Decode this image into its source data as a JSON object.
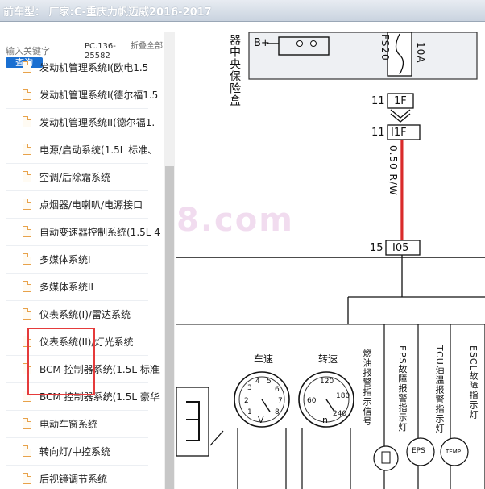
{
  "window": {
    "title": "前车型： 厂家:C-重庆力帆迈威2016-2017"
  },
  "search": {
    "placeholder": "输入关键字",
    "button": "查询",
    "code": "PC.136-25582",
    "fold": "折叠全部"
  },
  "tree": {
    "partial_item": "发动机管理系统I(欧电1.5",
    "items": [
      "发动机管理系统I(德尔福1.5",
      "发动机管理系统II(德尔福1.",
      "电源/启动系统(1.5L 标准、",
      "空调/后除霜系统",
      "点烟器/电喇叭/电源接口",
      "自动变速器控制系统(1.5L 4",
      "多媒体系统I",
      "多媒体系统II",
      "仪表系统(I)/雷达系统",
      "仪表系统(II)/灯光系统",
      "BCM 控制器系统(1.5L 标准",
      "BCM 控制器系统(1.5L 豪华",
      "电动车窗系统",
      "转向灯/中控系统",
      "后视镜调节系统"
    ]
  },
  "diagram": {
    "fuse_box_label": "器中央保险盒",
    "b_plus": "B+",
    "fuse_name": "FS20",
    "fuse_rating": "10A",
    "conn1_pin": "11",
    "conn1_name": "1F",
    "conn2_pin": "11",
    "conn2_name": "I1F",
    "wire_label": "0.50 R/W",
    "conn3_pin": "15",
    "conn3_name": "I05",
    "gauges": {
      "tach_label": "车速",
      "speed_label": "转速",
      "tach_ticks": [
        "1",
        "2",
        "3",
        "4",
        "5",
        "6",
        "7",
        "8"
      ],
      "speed_ticks": [
        "60",
        "120",
        "180",
        "240"
      ],
      "v_label": "V",
      "n_label": "n"
    },
    "indicators": [
      "燃油报警指示信号",
      "EPS故障报警指示灯",
      "TCU油温报警指示灯",
      "ESCL故障指示灯"
    ],
    "badges": [
      "EPS",
      "TEMP"
    ],
    "watermark": "8.com"
  },
  "colors": {
    "accent": "#1a6fd1",
    "wire": "#d92b2b",
    "highlight": "#e53b3b"
  }
}
